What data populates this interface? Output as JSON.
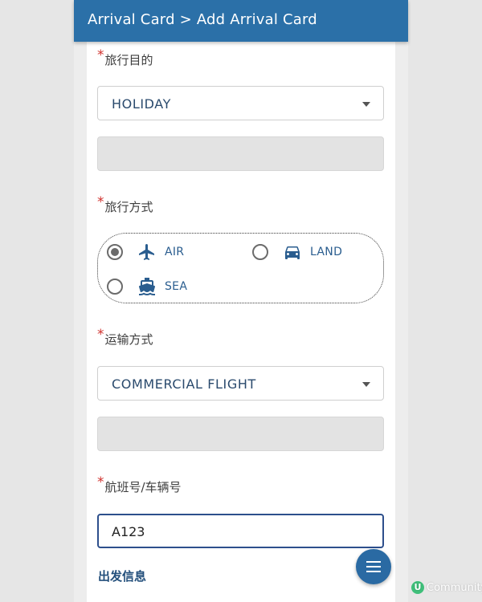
{
  "header": {
    "title": "Arrival Card > Add Arrival Card"
  },
  "form": {
    "required_mark": "*",
    "travel_purpose": {
      "label": "旅行目的",
      "value": "HOLIDAY"
    },
    "travel_mode": {
      "label": "旅行方式",
      "options": [
        {
          "label": "AIR",
          "icon": "plane-icon",
          "selected": true
        },
        {
          "label": "LAND",
          "icon": "car-icon",
          "selected": false
        },
        {
          "label": "SEA",
          "icon": "ship-icon",
          "selected": false
        }
      ]
    },
    "transport_mode": {
      "label": "运输方式",
      "value": "COMMERCIAL FLIGHT"
    },
    "flight_no": {
      "label": "航班号/车辆号",
      "value": "A123"
    },
    "departure_section": "出发信息"
  },
  "watermark": {
    "logo": "U",
    "text": "Community"
  },
  "colors": {
    "header": "#2b70a8",
    "accent": "#2a5d8f",
    "required": "#d0312d",
    "fab": "#2a6aa3"
  }
}
